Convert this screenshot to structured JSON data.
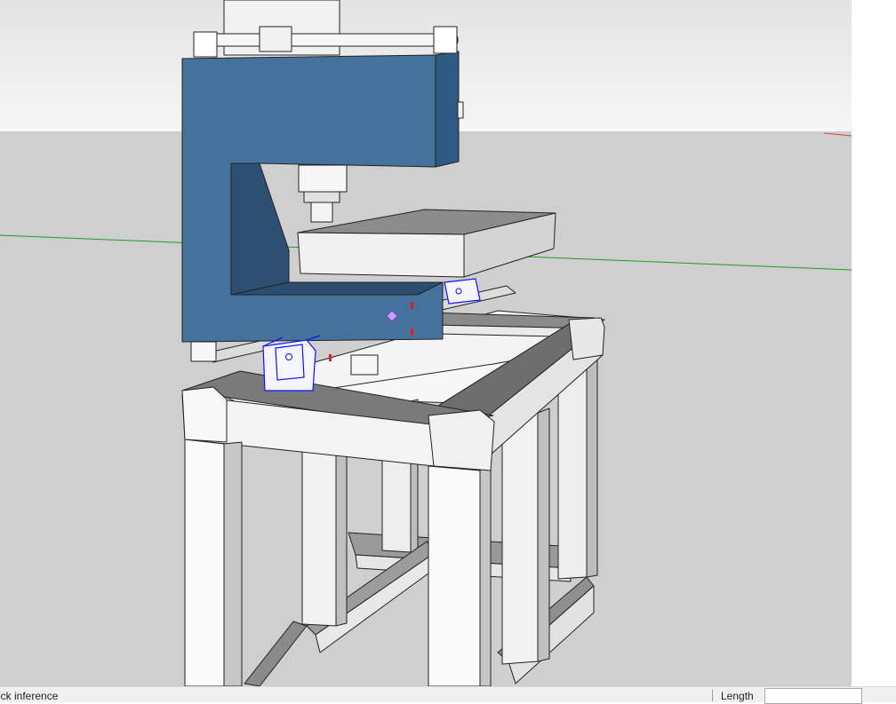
{
  "viewport": {
    "sky_color": "#ececec",
    "ground_color": "#cfcfcf",
    "green_axis_color": "#1f9a1f",
    "red_axis_color": "#e04040",
    "frame_color": "#3f6f9a",
    "selection_color": "#1010ff"
  },
  "statusbar": {
    "hint_text": "ock inference",
    "measurement_label": "Length",
    "measurement_value": ""
  }
}
